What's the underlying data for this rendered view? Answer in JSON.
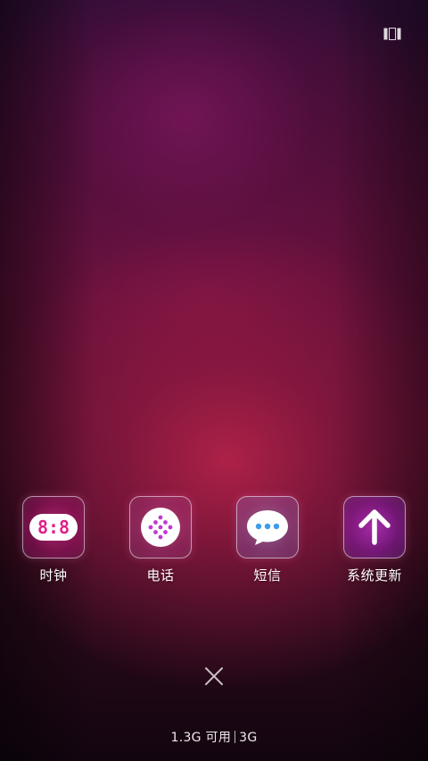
{
  "recents": {
    "apps": [
      {
        "label": "时钟",
        "icon": "clock-icon",
        "clock_digits": "8:8"
      },
      {
        "label": "电话",
        "icon": "phone-dialpad-icon"
      },
      {
        "label": "短信",
        "icon": "message-bubble-icon"
      },
      {
        "label": "系统更新",
        "icon": "arrow-up-icon"
      }
    ]
  },
  "memory": {
    "available": "1.3G 可用",
    "total": "3G"
  },
  "colors": {
    "clock_accent": "#ff2aa0",
    "phone_accent": "#c03ad0",
    "sms_accent": "#4aa6f0",
    "update_accent": "#d040ff"
  }
}
